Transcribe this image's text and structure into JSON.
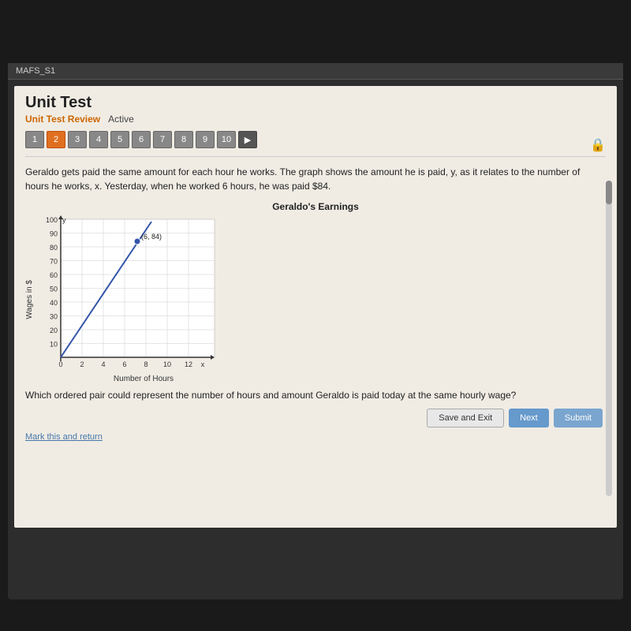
{
  "topbar": {
    "label": "MAFS_S1"
  },
  "page": {
    "title": "Unit Test",
    "subtitle": "Unit Test Review",
    "status": "Active"
  },
  "nav": {
    "buttons": [
      "1",
      "2",
      "3",
      "4",
      "5",
      "6",
      "7",
      "8",
      "9",
      "10"
    ],
    "active_index": 1,
    "arrow_label": "▶"
  },
  "question": {
    "text": "Geraldo gets paid the same amount for each hour he works. The graph shows the amount he is paid, y, as it relates to the number of hours he works, x. Yesterday, when he worked 6 hours, he was paid $84.",
    "chart_title": "Geraldo's Earnings",
    "x_axis_label": "Number of Hours",
    "y_axis_label": "Wages in $",
    "point_label": "(6, 84)",
    "sub_question": "Which ordered pair could represent the number of hours and amount Geraldo is paid today at the same hourly wage?"
  },
  "buttons": {
    "save_exit": "Save and Exit",
    "next": "Next",
    "submit": "Submit"
  },
  "footer": {
    "mark_return": "Mark this and return"
  }
}
